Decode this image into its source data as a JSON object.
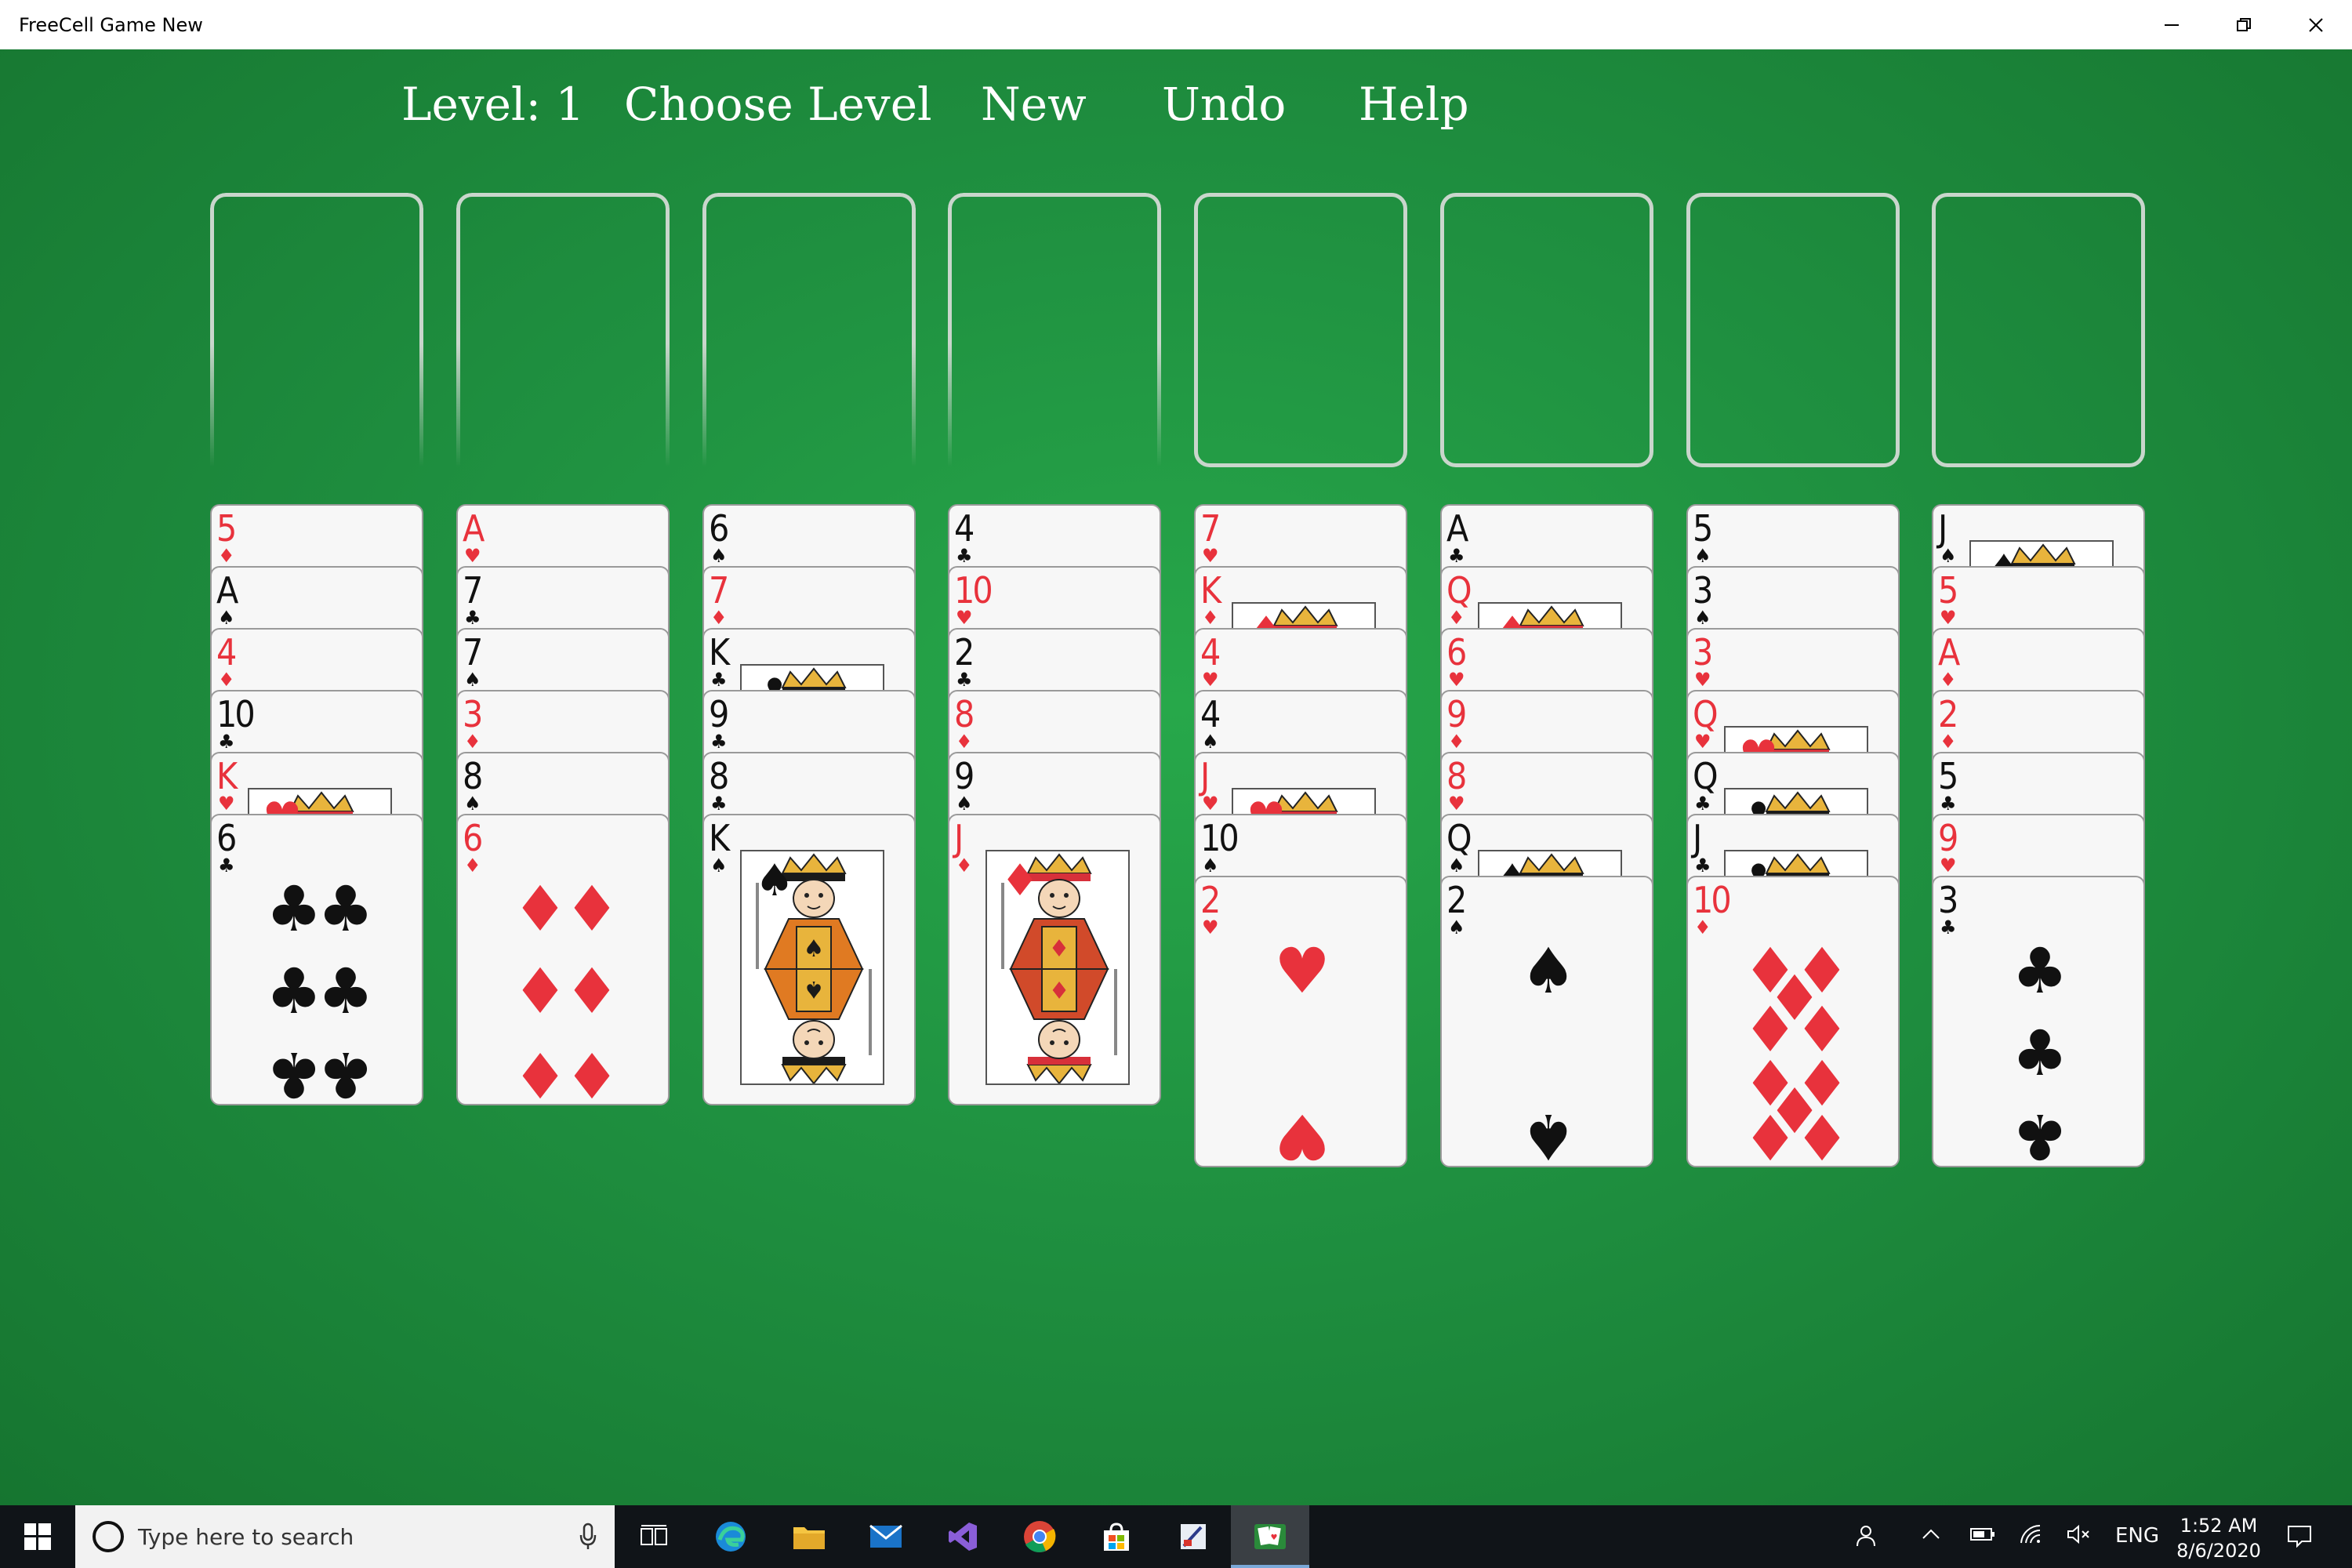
{
  "window": {
    "title": "FreeCell Game New",
    "minimize_label": "Minimize",
    "maximize_label": "Restore",
    "close_label": "Close"
  },
  "menu": {
    "level": "Level: 1",
    "choose_level": "Choose Level",
    "new": "New",
    "undo": "Undo",
    "help": "Help"
  },
  "colors": {
    "felt": "#1f9040",
    "red_suit": "#e8323c",
    "black_suit": "#111111",
    "slot_border": "#c9d6cc"
  },
  "freecells": [
    {
      "card": ""
    },
    {
      "card": ""
    },
    {
      "card": ""
    },
    {
      "card": ""
    }
  ],
  "foundations": [
    {
      "card": ""
    },
    {
      "card": ""
    },
    {
      "card": ""
    },
    {
      "card": ""
    }
  ],
  "tableau": [
    [
      {
        "rank": "5",
        "suit": "diamonds"
      },
      {
        "rank": "A",
        "suit": "spades"
      },
      {
        "rank": "4",
        "suit": "diamonds"
      },
      {
        "rank": "10",
        "suit": "clubs"
      },
      {
        "rank": "K",
        "suit": "hearts"
      },
      {
        "rank": "6",
        "suit": "clubs"
      }
    ],
    [
      {
        "rank": "A",
        "suit": "hearts"
      },
      {
        "rank": "7",
        "suit": "clubs"
      },
      {
        "rank": "7",
        "suit": "spades"
      },
      {
        "rank": "3",
        "suit": "diamonds"
      },
      {
        "rank": "8",
        "suit": "spades"
      },
      {
        "rank": "6",
        "suit": "diamonds"
      }
    ],
    [
      {
        "rank": "6",
        "suit": "spades"
      },
      {
        "rank": "7",
        "suit": "diamonds"
      },
      {
        "rank": "K",
        "suit": "clubs"
      },
      {
        "rank": "9",
        "suit": "clubs"
      },
      {
        "rank": "8",
        "suit": "clubs"
      },
      {
        "rank": "K",
        "suit": "spades"
      }
    ],
    [
      {
        "rank": "4",
        "suit": "clubs"
      },
      {
        "rank": "10",
        "suit": "hearts"
      },
      {
        "rank": "2",
        "suit": "clubs"
      },
      {
        "rank": "8",
        "suit": "diamonds"
      },
      {
        "rank": "9",
        "suit": "spades"
      },
      {
        "rank": "J",
        "suit": "diamonds"
      }
    ],
    [
      {
        "rank": "7",
        "suit": "hearts"
      },
      {
        "rank": "K",
        "suit": "diamonds"
      },
      {
        "rank": "4",
        "suit": "hearts"
      },
      {
        "rank": "4",
        "suit": "spades"
      },
      {
        "rank": "J",
        "suit": "hearts"
      },
      {
        "rank": "10",
        "suit": "spades"
      },
      {
        "rank": "2",
        "suit": "hearts"
      }
    ],
    [
      {
        "rank": "A",
        "suit": "clubs"
      },
      {
        "rank": "Q",
        "suit": "diamonds"
      },
      {
        "rank": "6",
        "suit": "hearts"
      },
      {
        "rank": "9",
        "suit": "diamonds"
      },
      {
        "rank": "8",
        "suit": "hearts"
      },
      {
        "rank": "Q",
        "suit": "spades"
      },
      {
        "rank": "2",
        "suit": "spades"
      }
    ],
    [
      {
        "rank": "5",
        "suit": "spades"
      },
      {
        "rank": "3",
        "suit": "spades"
      },
      {
        "rank": "3",
        "suit": "hearts"
      },
      {
        "rank": "Q",
        "suit": "hearts"
      },
      {
        "rank": "Q",
        "suit": "clubs"
      },
      {
        "rank": "J",
        "suit": "clubs"
      },
      {
        "rank": "10",
        "suit": "diamonds"
      }
    ],
    [
      {
        "rank": "J",
        "suit": "spades"
      },
      {
        "rank": "5",
        "suit": "hearts"
      },
      {
        "rank": "A",
        "suit": "diamonds"
      },
      {
        "rank": "2",
        "suit": "diamonds"
      },
      {
        "rank": "5",
        "suit": "clubs"
      },
      {
        "rank": "9",
        "suit": "hearts"
      },
      {
        "rank": "3",
        "suit": "clubs"
      }
    ]
  ],
  "taskbar": {
    "search_placeholder": "Type here to search",
    "apps": [
      "task-view-icon",
      "edge-icon",
      "file-explorer-icon",
      "mail-icon",
      "visual-studio-icon",
      "chrome-icon",
      "store-icon",
      "paint-icon",
      "freecell-icon"
    ],
    "language": "ENG",
    "time": "1:52 AM",
    "date": "8/6/2020"
  }
}
